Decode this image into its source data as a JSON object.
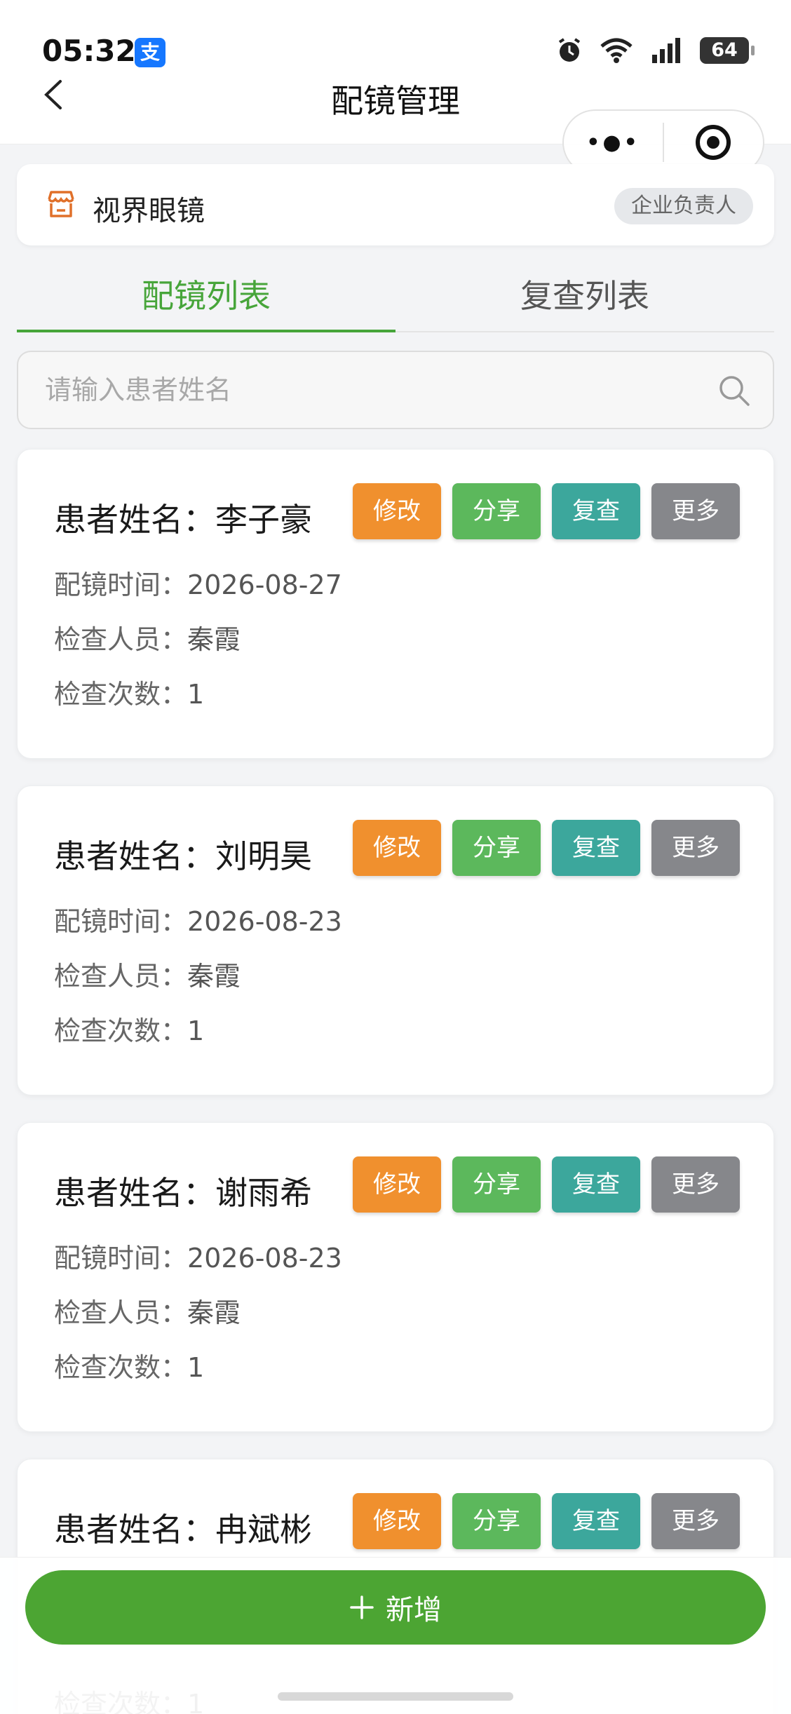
{
  "status_bar": {
    "time": "05:32",
    "app_badge": "支",
    "battery": "64",
    "icons": [
      "alarm-icon",
      "wifi-icon",
      "signal-icon",
      "battery-icon"
    ]
  },
  "header": {
    "title": "配镜管理",
    "back_icon": "chevron-left-icon",
    "capsule": {
      "more_icon": "ellipsis-icon",
      "close_icon": "target-icon"
    }
  },
  "store": {
    "name": "视界眼镜",
    "role": "企业负责人",
    "icon": "store-icon"
  },
  "tabs": [
    {
      "label": "配镜列表",
      "active": true
    },
    {
      "label": "复查列表",
      "active": false
    }
  ],
  "search": {
    "placeholder": "请输入患者姓名",
    "value": ""
  },
  "labels": {
    "name_prefix": "患者姓名：",
    "time_label": "配镜时间：",
    "inspector_label": "检查人员：",
    "count_label": "检查次数："
  },
  "actions": {
    "edit": "修改",
    "share": "分享",
    "review": "复查",
    "more": "更多"
  },
  "records": [
    {
      "name": "患者姓名：李子豪",
      "time": "2026-08-27",
      "inspector": "秦霞",
      "count": "1"
    },
    {
      "name": "患者姓名：刘明昊",
      "time": "2026-08-23",
      "inspector": "秦霞",
      "count": "1"
    },
    {
      "name": "患者姓名：谢雨希",
      "time": "2026-08-23",
      "inspector": "秦霞",
      "count": "1"
    },
    {
      "name": "患者姓名：冉斌彬",
      "time": "",
      "inspector": "",
      "count": "1"
    }
  ],
  "add_button": {
    "label": "新增",
    "icon": "plus-icon"
  },
  "colors": {
    "accent_green": "#47a53a",
    "edit_orange": "#f0902e",
    "share_green": "#5cb85c",
    "review_teal": "#3ca79c",
    "more_gray": "#86878b"
  }
}
